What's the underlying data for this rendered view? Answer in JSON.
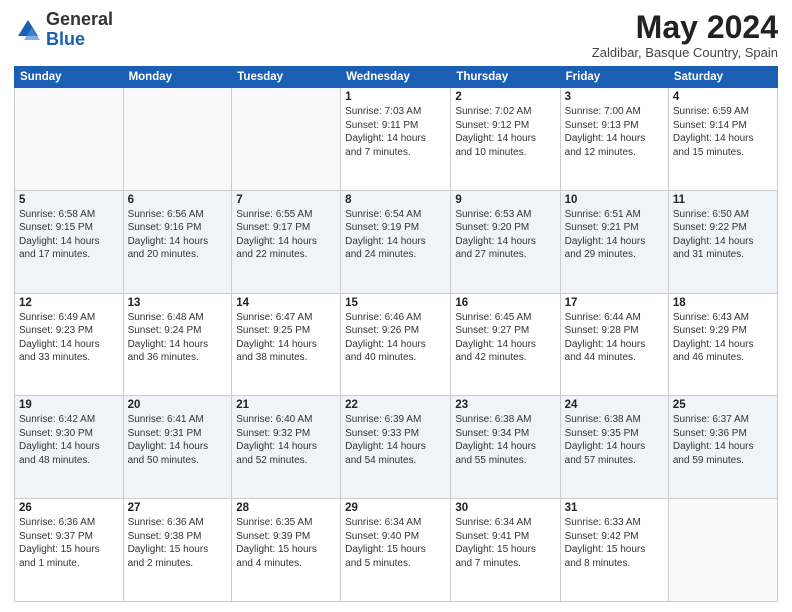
{
  "header": {
    "logo_general": "General",
    "logo_blue": "Blue",
    "month_title": "May 2024",
    "location": "Zaldibar, Basque Country, Spain"
  },
  "days_of_week": [
    "Sunday",
    "Monday",
    "Tuesday",
    "Wednesday",
    "Thursday",
    "Friday",
    "Saturday"
  ],
  "weeks": [
    [
      {
        "day": "",
        "info": ""
      },
      {
        "day": "",
        "info": ""
      },
      {
        "day": "",
        "info": ""
      },
      {
        "day": "1",
        "info": "Sunrise: 7:03 AM\nSunset: 9:11 PM\nDaylight: 14 hours\nand 7 minutes."
      },
      {
        "day": "2",
        "info": "Sunrise: 7:02 AM\nSunset: 9:12 PM\nDaylight: 14 hours\nand 10 minutes."
      },
      {
        "day": "3",
        "info": "Sunrise: 7:00 AM\nSunset: 9:13 PM\nDaylight: 14 hours\nand 12 minutes."
      },
      {
        "day": "4",
        "info": "Sunrise: 6:59 AM\nSunset: 9:14 PM\nDaylight: 14 hours\nand 15 minutes."
      }
    ],
    [
      {
        "day": "5",
        "info": "Sunrise: 6:58 AM\nSunset: 9:15 PM\nDaylight: 14 hours\nand 17 minutes."
      },
      {
        "day": "6",
        "info": "Sunrise: 6:56 AM\nSunset: 9:16 PM\nDaylight: 14 hours\nand 20 minutes."
      },
      {
        "day": "7",
        "info": "Sunrise: 6:55 AM\nSunset: 9:17 PM\nDaylight: 14 hours\nand 22 minutes."
      },
      {
        "day": "8",
        "info": "Sunrise: 6:54 AM\nSunset: 9:19 PM\nDaylight: 14 hours\nand 24 minutes."
      },
      {
        "day": "9",
        "info": "Sunrise: 6:53 AM\nSunset: 9:20 PM\nDaylight: 14 hours\nand 27 minutes."
      },
      {
        "day": "10",
        "info": "Sunrise: 6:51 AM\nSunset: 9:21 PM\nDaylight: 14 hours\nand 29 minutes."
      },
      {
        "day": "11",
        "info": "Sunrise: 6:50 AM\nSunset: 9:22 PM\nDaylight: 14 hours\nand 31 minutes."
      }
    ],
    [
      {
        "day": "12",
        "info": "Sunrise: 6:49 AM\nSunset: 9:23 PM\nDaylight: 14 hours\nand 33 minutes."
      },
      {
        "day": "13",
        "info": "Sunrise: 6:48 AM\nSunset: 9:24 PM\nDaylight: 14 hours\nand 36 minutes."
      },
      {
        "day": "14",
        "info": "Sunrise: 6:47 AM\nSunset: 9:25 PM\nDaylight: 14 hours\nand 38 minutes."
      },
      {
        "day": "15",
        "info": "Sunrise: 6:46 AM\nSunset: 9:26 PM\nDaylight: 14 hours\nand 40 minutes."
      },
      {
        "day": "16",
        "info": "Sunrise: 6:45 AM\nSunset: 9:27 PM\nDaylight: 14 hours\nand 42 minutes."
      },
      {
        "day": "17",
        "info": "Sunrise: 6:44 AM\nSunset: 9:28 PM\nDaylight: 14 hours\nand 44 minutes."
      },
      {
        "day": "18",
        "info": "Sunrise: 6:43 AM\nSunset: 9:29 PM\nDaylight: 14 hours\nand 46 minutes."
      }
    ],
    [
      {
        "day": "19",
        "info": "Sunrise: 6:42 AM\nSunset: 9:30 PM\nDaylight: 14 hours\nand 48 minutes."
      },
      {
        "day": "20",
        "info": "Sunrise: 6:41 AM\nSunset: 9:31 PM\nDaylight: 14 hours\nand 50 minutes."
      },
      {
        "day": "21",
        "info": "Sunrise: 6:40 AM\nSunset: 9:32 PM\nDaylight: 14 hours\nand 52 minutes."
      },
      {
        "day": "22",
        "info": "Sunrise: 6:39 AM\nSunset: 9:33 PM\nDaylight: 14 hours\nand 54 minutes."
      },
      {
        "day": "23",
        "info": "Sunrise: 6:38 AM\nSunset: 9:34 PM\nDaylight: 14 hours\nand 55 minutes."
      },
      {
        "day": "24",
        "info": "Sunrise: 6:38 AM\nSunset: 9:35 PM\nDaylight: 14 hours\nand 57 minutes."
      },
      {
        "day": "25",
        "info": "Sunrise: 6:37 AM\nSunset: 9:36 PM\nDaylight: 14 hours\nand 59 minutes."
      }
    ],
    [
      {
        "day": "26",
        "info": "Sunrise: 6:36 AM\nSunset: 9:37 PM\nDaylight: 15 hours\nand 1 minute."
      },
      {
        "day": "27",
        "info": "Sunrise: 6:36 AM\nSunset: 9:38 PM\nDaylight: 15 hours\nand 2 minutes."
      },
      {
        "day": "28",
        "info": "Sunrise: 6:35 AM\nSunset: 9:39 PM\nDaylight: 15 hours\nand 4 minutes."
      },
      {
        "day": "29",
        "info": "Sunrise: 6:34 AM\nSunset: 9:40 PM\nDaylight: 15 hours\nand 5 minutes."
      },
      {
        "day": "30",
        "info": "Sunrise: 6:34 AM\nSunset: 9:41 PM\nDaylight: 15 hours\nand 7 minutes."
      },
      {
        "day": "31",
        "info": "Sunrise: 6:33 AM\nSunset: 9:42 PM\nDaylight: 15 hours\nand 8 minutes."
      },
      {
        "day": "",
        "info": ""
      }
    ]
  ]
}
